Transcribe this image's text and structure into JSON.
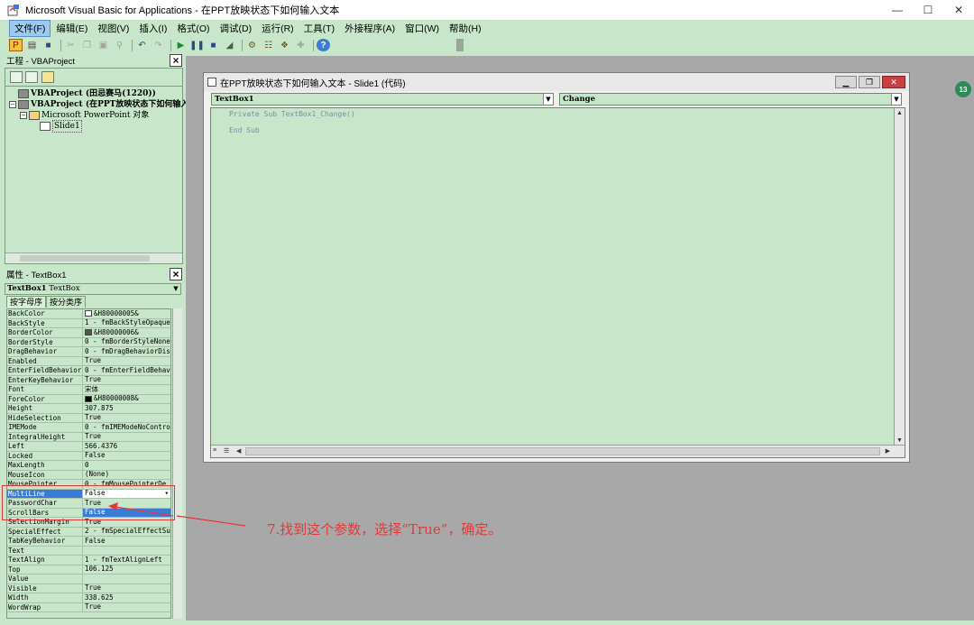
{
  "window": {
    "title": "Microsoft Visual Basic for Applications - 在PPT放映状态下如何输入文本",
    "controls": {
      "minimize": "—",
      "maximize": "☐",
      "close": "✕"
    }
  },
  "menu": [
    {
      "label": "文件(F)",
      "active": true
    },
    {
      "label": "编辑(E)"
    },
    {
      "label": "视图(V)"
    },
    {
      "label": "插入(I)"
    },
    {
      "label": "格式(O)"
    },
    {
      "label": "调试(D)"
    },
    {
      "label": "运行(R)"
    },
    {
      "label": "工具(T)"
    },
    {
      "label": "外接程序(A)"
    },
    {
      "label": "窗口(W)"
    },
    {
      "label": "帮助(H)"
    }
  ],
  "project_pane": {
    "title": "工程 - VBAProject",
    "tree": [
      {
        "label": "VBAProject (田忌赛马(1220))",
        "level": 0,
        "expander": "",
        "bold": true
      },
      {
        "label": "VBAProject (在PPT放映状态下如何输入",
        "level": 0,
        "expander": "−",
        "bold": true
      },
      {
        "label": "Microsoft PowerPoint 对象",
        "level": 1,
        "expander": "−",
        "bold": false
      },
      {
        "label": "Slide1",
        "level": 2,
        "expander": "",
        "bold": false
      }
    ]
  },
  "properties_pane": {
    "title": "属性 - TextBox1",
    "object_name": "TextBox1",
    "object_type": "TextBox",
    "tabs": [
      "按字母序",
      "按分类序"
    ],
    "rows": [
      {
        "name": "BackColor",
        "value": "&H80000005&",
        "swatch": "#ffffff"
      },
      {
        "name": "BackStyle",
        "value": "1 - fmBackStyleOpaque"
      },
      {
        "name": "BorderColor",
        "value": "&H80000006&",
        "swatch": "#555555"
      },
      {
        "name": "BorderStyle",
        "value": "0 - fmBorderStyleNone"
      },
      {
        "name": "DragBehavior",
        "value": "0 - fmDragBehaviorDis"
      },
      {
        "name": "Enabled",
        "value": "True"
      },
      {
        "name": "EnterFieldBehavior",
        "value": "0 - fmEnterFieldBehav"
      },
      {
        "name": "EnterKeyBehavior",
        "value": "True"
      },
      {
        "name": "Font",
        "value": "宋体"
      },
      {
        "name": "ForeColor",
        "value": "&H80000008&",
        "swatch": "#000000"
      },
      {
        "name": "Height",
        "value": "307.875"
      },
      {
        "name": "HideSelection",
        "value": "True"
      },
      {
        "name": "IMEMode",
        "value": "0 - fmIMEModeNoContro"
      },
      {
        "name": "IntegralHeight",
        "value": "True"
      },
      {
        "name": "Left",
        "value": "566.4376"
      },
      {
        "name": "Locked",
        "value": "False"
      },
      {
        "name": "MaxLength",
        "value": "0"
      },
      {
        "name": "MouseIcon",
        "value": "(None)"
      },
      {
        "name": "MousePointer",
        "value": "0 - fmMousePointerDe"
      },
      {
        "name": "MultiLine",
        "value": "False",
        "selected": true,
        "dropdown": "▾"
      },
      {
        "name": "PasswordChar",
        "value": "True",
        "option": true
      },
      {
        "name": "ScrollBars",
        "value": "False",
        "option": true,
        "highlighted": true
      },
      {
        "name": "SelectionMargin",
        "value": "True"
      },
      {
        "name": "SpecialEffect",
        "value": "2 - fmSpecialEffectSu"
      },
      {
        "name": "TabKeyBehavior",
        "value": "False"
      },
      {
        "name": "Text",
        "value": ""
      },
      {
        "name": "TextAlign",
        "value": "1 - fmTextAlignLeft"
      },
      {
        "name": "Top",
        "value": "106.125"
      },
      {
        "name": "Value",
        "value": ""
      },
      {
        "name": "Visible",
        "value": "True"
      },
      {
        "name": "Width",
        "value": "338.625"
      },
      {
        "name": "WordWrap",
        "value": "True"
      }
    ]
  },
  "code_window": {
    "title": "在PPT放映状态下如何输入文本 - Slide1 (代码)",
    "object_combo": "TextBox1",
    "procedure_combo": "Change",
    "lines": [
      "Private Sub TextBox1_Change()",
      "",
      "End Sub"
    ]
  },
  "annotation": {
    "text": "7.找到这个参数，选择“True”，确定。",
    "color": "#e23a3a"
  },
  "badge": "13",
  "colors": {
    "accent": "#3a7bd5",
    "background": "#c8e6c9",
    "workspace": "#a8a8a8"
  }
}
